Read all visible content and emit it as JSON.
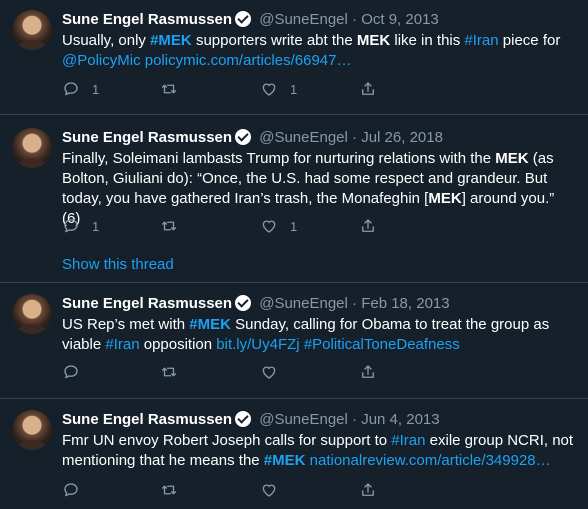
{
  "tweets": [
    {
      "name": "Sune Engel Rasmussen",
      "handle": "@SuneEngel",
      "dot": "·",
      "date": "Oct 9, 2013",
      "line1": [
        {
          "t": "Usually, only ",
          "s": "plain"
        },
        {
          "t": "#MEK",
          "s": "hashtag-bold"
        },
        {
          "t": " supporters write abt the ",
          "s": "plain"
        },
        {
          "t": "MEK",
          "s": "bold"
        },
        {
          "t": " like in this ",
          "s": "plain"
        },
        {
          "t": "#Iran",
          "s": "hashtag"
        },
        {
          "t": " piece for",
          "s": "plain"
        }
      ],
      "line2": [
        {
          "t": "@PolicyMic",
          "s": "link"
        },
        {
          "t": " ",
          "s": "plain"
        },
        {
          "t": "policymic.com/articles/66947…",
          "s": "link"
        }
      ],
      "replies": "1",
      "retweets": "",
      "likes": "1"
    },
    {
      "name": "Sune Engel Rasmussen",
      "handle": "@SuneEngel",
      "dot": "·",
      "date": "Jul 26, 2018",
      "line1": [
        {
          "t": "Finally, Soleimani lambasts Trump for nurturing relations with the ",
          "s": "plain"
        },
        {
          "t": "MEK",
          "s": "bold"
        },
        {
          "t": " (as",
          "s": "plain"
        }
      ],
      "line2": [
        {
          "t": "Bolton, Giuliani do): “Once, the U.S. had some respect and grandeur. But",
          "s": "plain"
        }
      ],
      "line3": [
        {
          "t": "today, you have gathered Iran’s trash, the Monafeghin [",
          "s": "plain"
        },
        {
          "t": "MEK",
          "s": "bold"
        },
        {
          "t": "] around you.” (6)",
          "s": "plain"
        }
      ],
      "replies": "1",
      "retweets": "",
      "likes": "1",
      "show_thread": "Show this thread"
    },
    {
      "name": "Sune Engel Rasmussen",
      "handle": "@SuneEngel",
      "dot": "·",
      "date": "Feb 18, 2013",
      "line1": [
        {
          "t": "US Rep’s met with ",
          "s": "plain"
        },
        {
          "t": "#MEK",
          "s": "hashtag-bold"
        },
        {
          "t": " Sunday, calling for Obama to treat the group as",
          "s": "plain"
        }
      ],
      "line2": [
        {
          "t": "viable ",
          "s": "plain"
        },
        {
          "t": "#Iran",
          "s": "hashtag"
        },
        {
          "t": " opposition ",
          "s": "plain"
        },
        {
          "t": "bit.ly/Uy4FZj",
          "s": "link"
        },
        {
          "t": " ",
          "s": "plain"
        },
        {
          "t": "#PoliticalToneDeafness",
          "s": "hashtag"
        }
      ],
      "replies": "",
      "retweets": "",
      "likes": ""
    },
    {
      "name": "Sune Engel Rasmussen",
      "handle": "@SuneEngel",
      "dot": "·",
      "date": "Jun 4, 2013",
      "line1": [
        {
          "t": "Fmr UN envoy Robert Joseph calls for support to ",
          "s": "plain"
        },
        {
          "t": "#Iran",
          "s": "hashtag"
        },
        {
          "t": " exile group NCRI, not",
          "s": "plain"
        }
      ],
      "line2": [
        {
          "t": "mentioning that he means the ",
          "s": "plain"
        },
        {
          "t": "#MEK",
          "s": "hashtag-bold"
        },
        {
          "t": " ",
          "s": "plain"
        },
        {
          "t": "nationalreview.com/article/349928…",
          "s": "link"
        }
      ],
      "replies": "",
      "retweets": "",
      "likes": ""
    }
  ],
  "colors": {
    "background": "#15202b",
    "link": "#1da1f2",
    "muted": "#8899a6",
    "divider": "#38444d"
  },
  "icons": [
    "verified-badge-icon",
    "reply-icon",
    "retweet-icon",
    "like-icon",
    "share-icon"
  ]
}
